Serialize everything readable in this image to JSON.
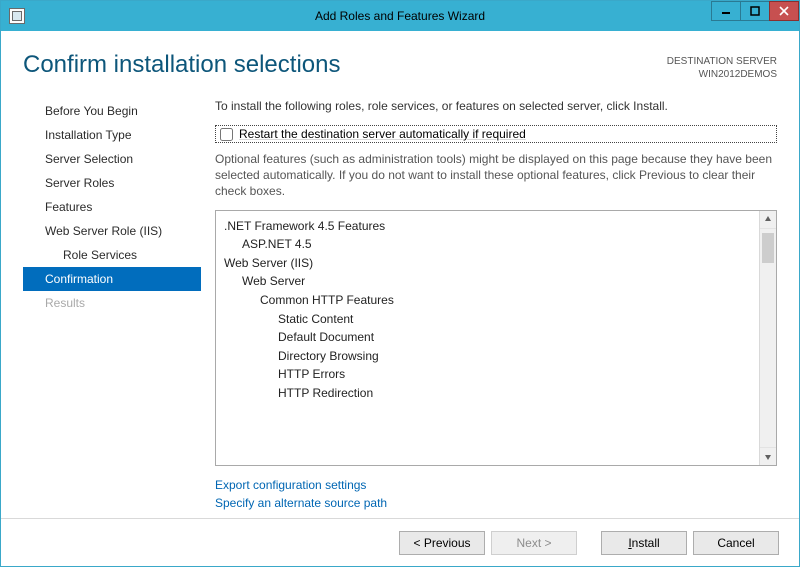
{
  "window": {
    "title": "Add Roles and Features Wizard"
  },
  "header": {
    "heading": "Confirm installation selections",
    "dest_label": "DESTINATION SERVER",
    "dest_name": "WIN2012DEMOS"
  },
  "sidebar": {
    "steps": [
      {
        "label": "Before You Begin",
        "sub": false,
        "active": false,
        "disabled": false
      },
      {
        "label": "Installation Type",
        "sub": false,
        "active": false,
        "disabled": false
      },
      {
        "label": "Server Selection",
        "sub": false,
        "active": false,
        "disabled": false
      },
      {
        "label": "Server Roles",
        "sub": false,
        "active": false,
        "disabled": false
      },
      {
        "label": "Features",
        "sub": false,
        "active": false,
        "disabled": false
      },
      {
        "label": "Web Server Role (IIS)",
        "sub": false,
        "active": false,
        "disabled": false
      },
      {
        "label": "Role Services",
        "sub": true,
        "active": false,
        "disabled": false
      },
      {
        "label": "Confirmation",
        "sub": false,
        "active": true,
        "disabled": false
      },
      {
        "label": "Results",
        "sub": false,
        "active": false,
        "disabled": true
      }
    ]
  },
  "main": {
    "intro": "To install the following roles, role services, or features on selected server, click Install.",
    "restart_label": "Restart the destination server automatically if required",
    "restart_checked": false,
    "note": "Optional features (such as administration tools) might be displayed on this page because they have been selected automatically. If you do not want to install these optional features, click Previous to clear their check boxes.",
    "items": [
      {
        "text": ".NET Framework 4.5 Features",
        "indent": 0
      },
      {
        "text": "ASP.NET 4.5",
        "indent": 1
      },
      {
        "text": "Web Server (IIS)",
        "indent": 0
      },
      {
        "text": "Web Server",
        "indent": 1
      },
      {
        "text": "Common HTTP Features",
        "indent": 2
      },
      {
        "text": "Static Content",
        "indent": 3
      },
      {
        "text": "Default Document",
        "indent": 3
      },
      {
        "text": "Directory Browsing",
        "indent": 3
      },
      {
        "text": "HTTP Errors",
        "indent": 3
      },
      {
        "text": "HTTP Redirection",
        "indent": 3
      }
    ],
    "links": {
      "export": "Export configuration settings",
      "source": "Specify an alternate source path"
    }
  },
  "footer": {
    "previous": "< Previous",
    "next": "Next >",
    "install": "Install",
    "install_key": "I",
    "cancel": "Cancel"
  }
}
